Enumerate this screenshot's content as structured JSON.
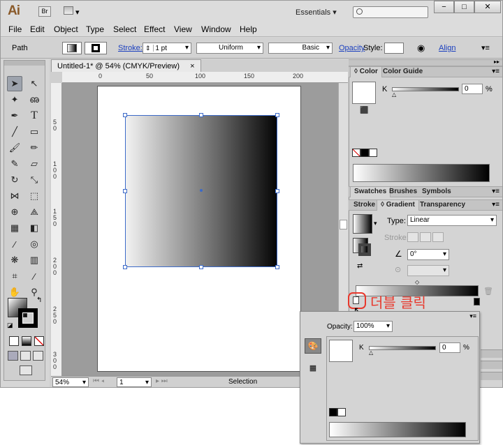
{
  "app": {
    "logo": "Ai",
    "bridge_label": "Br",
    "workspace": "Essentials",
    "workspace_arrow": "▾",
    "window_buttons": [
      "−",
      "□",
      "✕"
    ]
  },
  "menu": [
    "File",
    "Edit",
    "Object",
    "Type",
    "Select",
    "Effect",
    "View",
    "Window",
    "Help"
  ],
  "control": {
    "selection_type": "Path",
    "stroke_label": "Stroke:",
    "stroke_weight": "1 pt",
    "profile": "Uniform",
    "brush": "Basic",
    "opacity_label": "Opacity",
    "style_label": "Style:",
    "align_label": "Align"
  },
  "document": {
    "tab_title": "Untitled-1* @ 54% (CMYK/Preview)",
    "tab_close": "×",
    "ruler_h_ticks": [
      "0",
      "50",
      "100",
      "150",
      "200"
    ],
    "ruler_v_ticks": [
      "5\n0",
      "1\n0\n0",
      "1\n5\n0",
      "2\n0\n0",
      "2\n5\n0",
      "3\n0\n0"
    ],
    "zoom": "54%",
    "artboard_nav": "1",
    "status_tool": "Selection"
  },
  "panels": {
    "color": {
      "tabs": [
        "Color",
        "Color Guide"
      ],
      "k_label": "K",
      "k_value": "0",
      "percent": "%"
    },
    "swatches_row": [
      "Swatches",
      "Brushes",
      "Symbols"
    ],
    "gradient": {
      "tabs": [
        "Stroke",
        "Gradient",
        "Transparency"
      ],
      "type_label": "Type:",
      "type_value": "Linear",
      "stroke_label": "Stroke:",
      "angle_value": "0°"
    }
  },
  "popup": {
    "opacity_label": "Opacity:",
    "opacity_value": "100%",
    "k_label": "K",
    "k_value": "0",
    "percent": "%"
  },
  "annotation": {
    "text": "더블 클릭",
    "color": "#e8382c"
  },
  "colors": {
    "selection_blue": "#3c6ac8",
    "link_blue": "#1a3fbf"
  }
}
